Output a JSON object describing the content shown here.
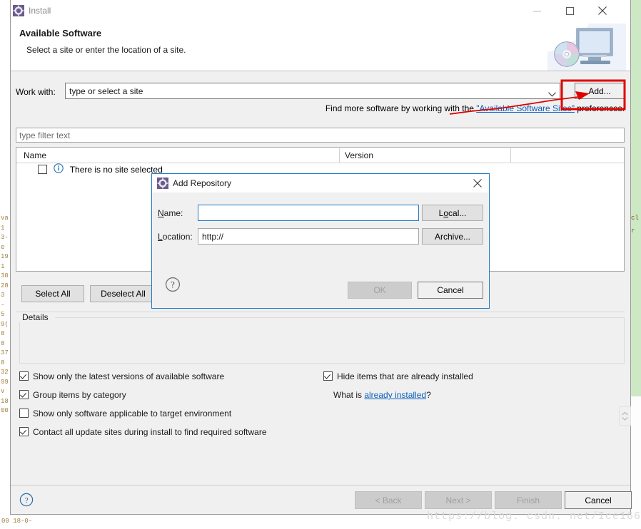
{
  "window": {
    "title": "Install",
    "icon": "eclipse-gear-icon",
    "minimize_label": "–",
    "maximize_label": "□",
    "close_label": "✕"
  },
  "header": {
    "title": "Available Software",
    "subtitle": "Select a site or enter the location of a site.",
    "art": "computer-cd-icon"
  },
  "workwith": {
    "label": "Work with:",
    "value": "type or select a site",
    "placeholder": "type or select a site",
    "add_label": "Add...",
    "find_prefix": "Find more software by working with the ",
    "find_link": "\"Available Software Sites\"",
    "find_suffix": " preferences."
  },
  "filter": {
    "placeholder": "type filter text",
    "value": "type filter text"
  },
  "tree": {
    "columns": [
      "Name",
      "Version",
      ""
    ],
    "rows": [
      {
        "checked": false,
        "icon": "info-icon",
        "name": "There is no site selected",
        "version": ""
      }
    ]
  },
  "tree_buttons": {
    "select_all": "Select All",
    "deselect_all": "Deselect All"
  },
  "details": {
    "legend": "Details",
    "content": ""
  },
  "options_left": [
    {
      "label": "Show only the latest versions of available software",
      "checked": true
    },
    {
      "label": "Group items by category",
      "checked": true
    },
    {
      "label": "Show only software applicable to target environment",
      "checked": false
    },
    {
      "label": "Contact all update sites during install to find required software",
      "checked": true
    }
  ],
  "options_right": {
    "hide_installed": {
      "label": "Hide items that are already installed",
      "checked": true
    },
    "what_is_prefix": "What is ",
    "what_is_link": "already installed",
    "what_is_suffix": "?"
  },
  "footer": {
    "help": "?",
    "back": "< Back",
    "next": "Next >",
    "finish": "Finish",
    "cancel": "Cancel",
    "back_enabled": false,
    "next_enabled": false,
    "finish_enabled": false,
    "cancel_enabled": true
  },
  "watermark": "https://blog. csdn. net/Ice166",
  "modal": {
    "title": "Add Repository",
    "icon": "eclipse-gear-icon",
    "close_label": "✕",
    "name_label": "Name:",
    "name_value": "",
    "location_label": "Location:",
    "location_value": "http://",
    "local_label": "Local...",
    "archive_label": "Archive...",
    "ok_label": "OK",
    "cancel_label": "Cancel",
    "help_label": "?",
    "ok_enabled": false
  },
  "annotation": {
    "color": "#e00000",
    "shape": "rectangle-with-arrow",
    "target": "Add..."
  },
  "background_editor": {
    "left_gutter": [
      "va",
      "1",
      "3-",
      "e",
      "19",
      "1",
      "30",
      "28",
      "3",
      "-",
      "5",
      "9(",
      "8",
      "8",
      "37",
      "8",
      "32",
      "99",
      "",
      "v",
      "18",
      "00"
    ],
    "bottom_text": "00  18-0-"
  }
}
